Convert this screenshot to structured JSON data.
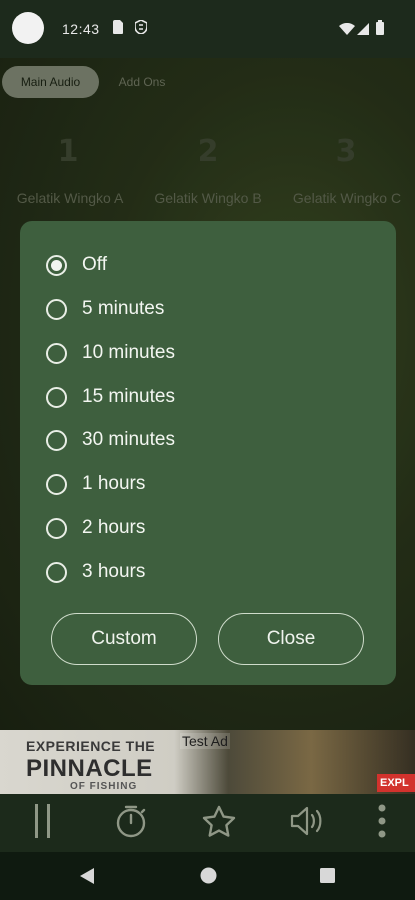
{
  "status_bar": {
    "time": "12:43",
    "icons": [
      "avatar-circle",
      "sim-card-icon",
      "vpn-icon",
      "wifi-icon",
      "cell-signal-icon",
      "battery-icon"
    ]
  },
  "tabs": [
    {
      "label": "Main Audio",
      "selected": true
    },
    {
      "label": "Add Ons",
      "selected": false
    }
  ],
  "tracks": [
    {
      "number": "1",
      "label": "Gelatik Wingko A"
    },
    {
      "number": "2",
      "label": "Gelatik Wingko B"
    },
    {
      "number": "3",
      "label": "Gelatik Wingko C"
    }
  ],
  "timer_dialog": {
    "options": [
      "Off",
      "5 minutes",
      "10 minutes",
      "15 minutes",
      "30 minutes",
      "1 hours",
      "2 hours",
      "3 hours"
    ],
    "selected": "Off",
    "custom_label": "Custom",
    "close_label": "Close"
  },
  "ad": {
    "tag": "Test Ad",
    "line1": "EXPERIENCE THE",
    "line2": "PINNACLE",
    "line3": "OF FISHING",
    "cta": "EXPL"
  },
  "controls": [
    "pause-icon",
    "timer-icon",
    "star-icon",
    "volume-icon",
    "more-icon"
  ],
  "nav": [
    "back-icon",
    "home-icon",
    "recents-icon"
  ],
  "colors": {
    "dialog_bg": "#3e5f3e",
    "status_bg": "#1d2a1c",
    "controls_bg": "#1c2a1b",
    "accent_text": "#f3f6f1"
  }
}
